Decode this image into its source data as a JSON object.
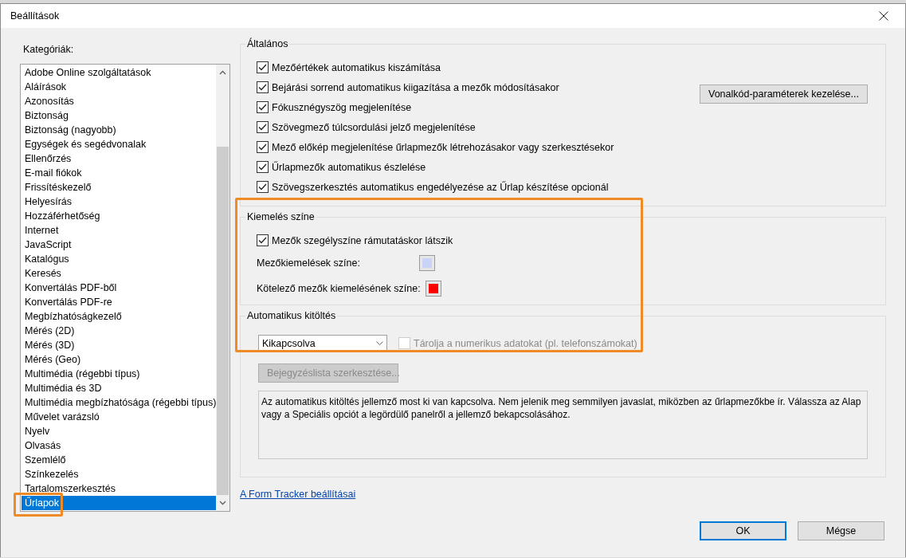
{
  "window": {
    "title": "Beállítások"
  },
  "categories": {
    "label": "Kategóriák:",
    "items": [
      {
        "label": "Adobe Online szolgáltatások",
        "selected": false
      },
      {
        "label": "Aláírások",
        "selected": false
      },
      {
        "label": "Azonosítás",
        "selected": false
      },
      {
        "label": "Biztonság",
        "selected": false
      },
      {
        "label": "Biztonság (nagyobb)",
        "selected": false
      },
      {
        "label": "Egységek és segédvonalak",
        "selected": false
      },
      {
        "label": "Ellenőrzés",
        "selected": false
      },
      {
        "label": "E-mail fiókok",
        "selected": false
      },
      {
        "label": "Frissítéskezelő",
        "selected": false
      },
      {
        "label": "Helyesírás",
        "selected": false
      },
      {
        "label": "Hozzáférhetőség",
        "selected": false
      },
      {
        "label": "Internet",
        "selected": false
      },
      {
        "label": "JavaScript",
        "selected": false
      },
      {
        "label": "Katalógus",
        "selected": false
      },
      {
        "label": "Keresés",
        "selected": false
      },
      {
        "label": "Konvertálás PDF-ből",
        "selected": false
      },
      {
        "label": "Konvertálás PDF-re",
        "selected": false
      },
      {
        "label": "Megbízhatóságkezelő",
        "selected": false
      },
      {
        "label": "Mérés (2D)",
        "selected": false
      },
      {
        "label": "Mérés (3D)",
        "selected": false
      },
      {
        "label": "Mérés (Geo)",
        "selected": false
      },
      {
        "label": "Multimédia (régebbi típus)",
        "selected": false
      },
      {
        "label": "Multimédia és 3D",
        "selected": false
      },
      {
        "label": "Multimédia megbízhatósága (régebbi típus)",
        "selected": false
      },
      {
        "label": "Művelet varázsló",
        "selected": false
      },
      {
        "label": "Nyelv",
        "selected": false
      },
      {
        "label": "Olvasás",
        "selected": false
      },
      {
        "label": "Szemlélő",
        "selected": false
      },
      {
        "label": "Színkezelés",
        "selected": false
      },
      {
        "label": "Tartalomszerkesztés",
        "selected": false
      },
      {
        "label": "Űrlapok",
        "selected": true
      }
    ]
  },
  "general": {
    "title": "Általános",
    "options": [
      {
        "label": "Mezőértékek automatikus kiszámítása",
        "checked": true
      },
      {
        "label": "Bejárási sorrend automatikus kiigazítása a mezők módosításakor",
        "checked": true
      },
      {
        "label": "Fókusznégyszög megjelenítése",
        "checked": true
      },
      {
        "label": "Szövegmező túlcsordulási jelző megjelenítése",
        "checked": true
      },
      {
        "label": "Mező előkép megjelenítése űrlapmezők létrehozásakor vagy szerkesztésekor",
        "checked": true
      },
      {
        "label": "Űrlapmezők automatikus észlelése",
        "checked": true
      },
      {
        "label": "Szövegszerkesztés automatikus engedélyezése az Űrlap készítése opcionál",
        "checked": true
      }
    ],
    "button": "Vonalkód-paraméterek kezelése..."
  },
  "highlight": {
    "title": "Kiemelés színe",
    "rows": [
      {
        "kind": "checkbox",
        "label": "Mezők szegélyszíne rámutatáskor látszik",
        "checked": true
      },
      {
        "kind": "color",
        "label": "Mezőkiemelések színe:",
        "color": "#c9d3f7"
      },
      {
        "kind": "color",
        "label": "Kötelező mezők kiemelésének színe:",
        "color": "#ff0000"
      }
    ]
  },
  "autofill": {
    "title": "Automatikus kitöltés",
    "dropdown": {
      "value": "Kikapcsolva"
    },
    "numeric": {
      "label": "Tárolja a numerikus adatokat (pl. telefonszámokat)",
      "checked": false,
      "disabled": true
    },
    "edit_button": {
      "label": "Bejegyzéslista szerkesztése...",
      "disabled": true
    },
    "description": "Az automatikus kitöltés jellemző most ki van kapcsolva. Nem jelenik meg semmilyen javaslat, miközben az űrlapmezőkbe ír. Válassza az Alap vagy a Speciális opciót a legördülő panelről a jellemző bekapcsolásához."
  },
  "link": "A Form Tracker beállításai",
  "buttons": [
    {
      "label": "OK",
      "kind": "default"
    },
    {
      "label": "Mégse",
      "kind": "normal"
    }
  ]
}
